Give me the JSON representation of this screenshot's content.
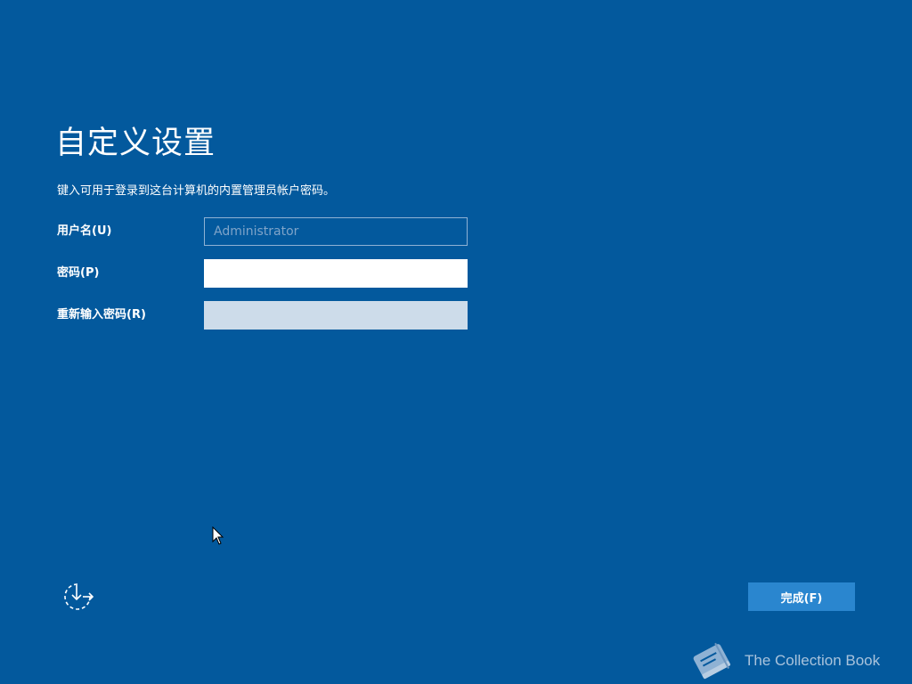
{
  "setup": {
    "title": "自定义设置",
    "instruction": "键入可用于登录到这台计算机的内置管理员帐户密码。",
    "fields": {
      "username": {
        "label": "用户名(U)",
        "value": "Administrator"
      },
      "password": {
        "label": "密码(P)",
        "value": ""
      },
      "reenter_password": {
        "label": "重新输入密码(R)",
        "value": ""
      }
    },
    "finish_label": "完成(F)"
  },
  "footer": {
    "accessibility_icon": "ease-of-access-icon"
  },
  "watermark": {
    "text": "The Collection Book",
    "icon": "book-icon"
  },
  "colors": {
    "background": "#03599d",
    "button": "#2a86cf",
    "disabled_input": "#cddcea",
    "watermark_text": "#a9c3dc"
  }
}
